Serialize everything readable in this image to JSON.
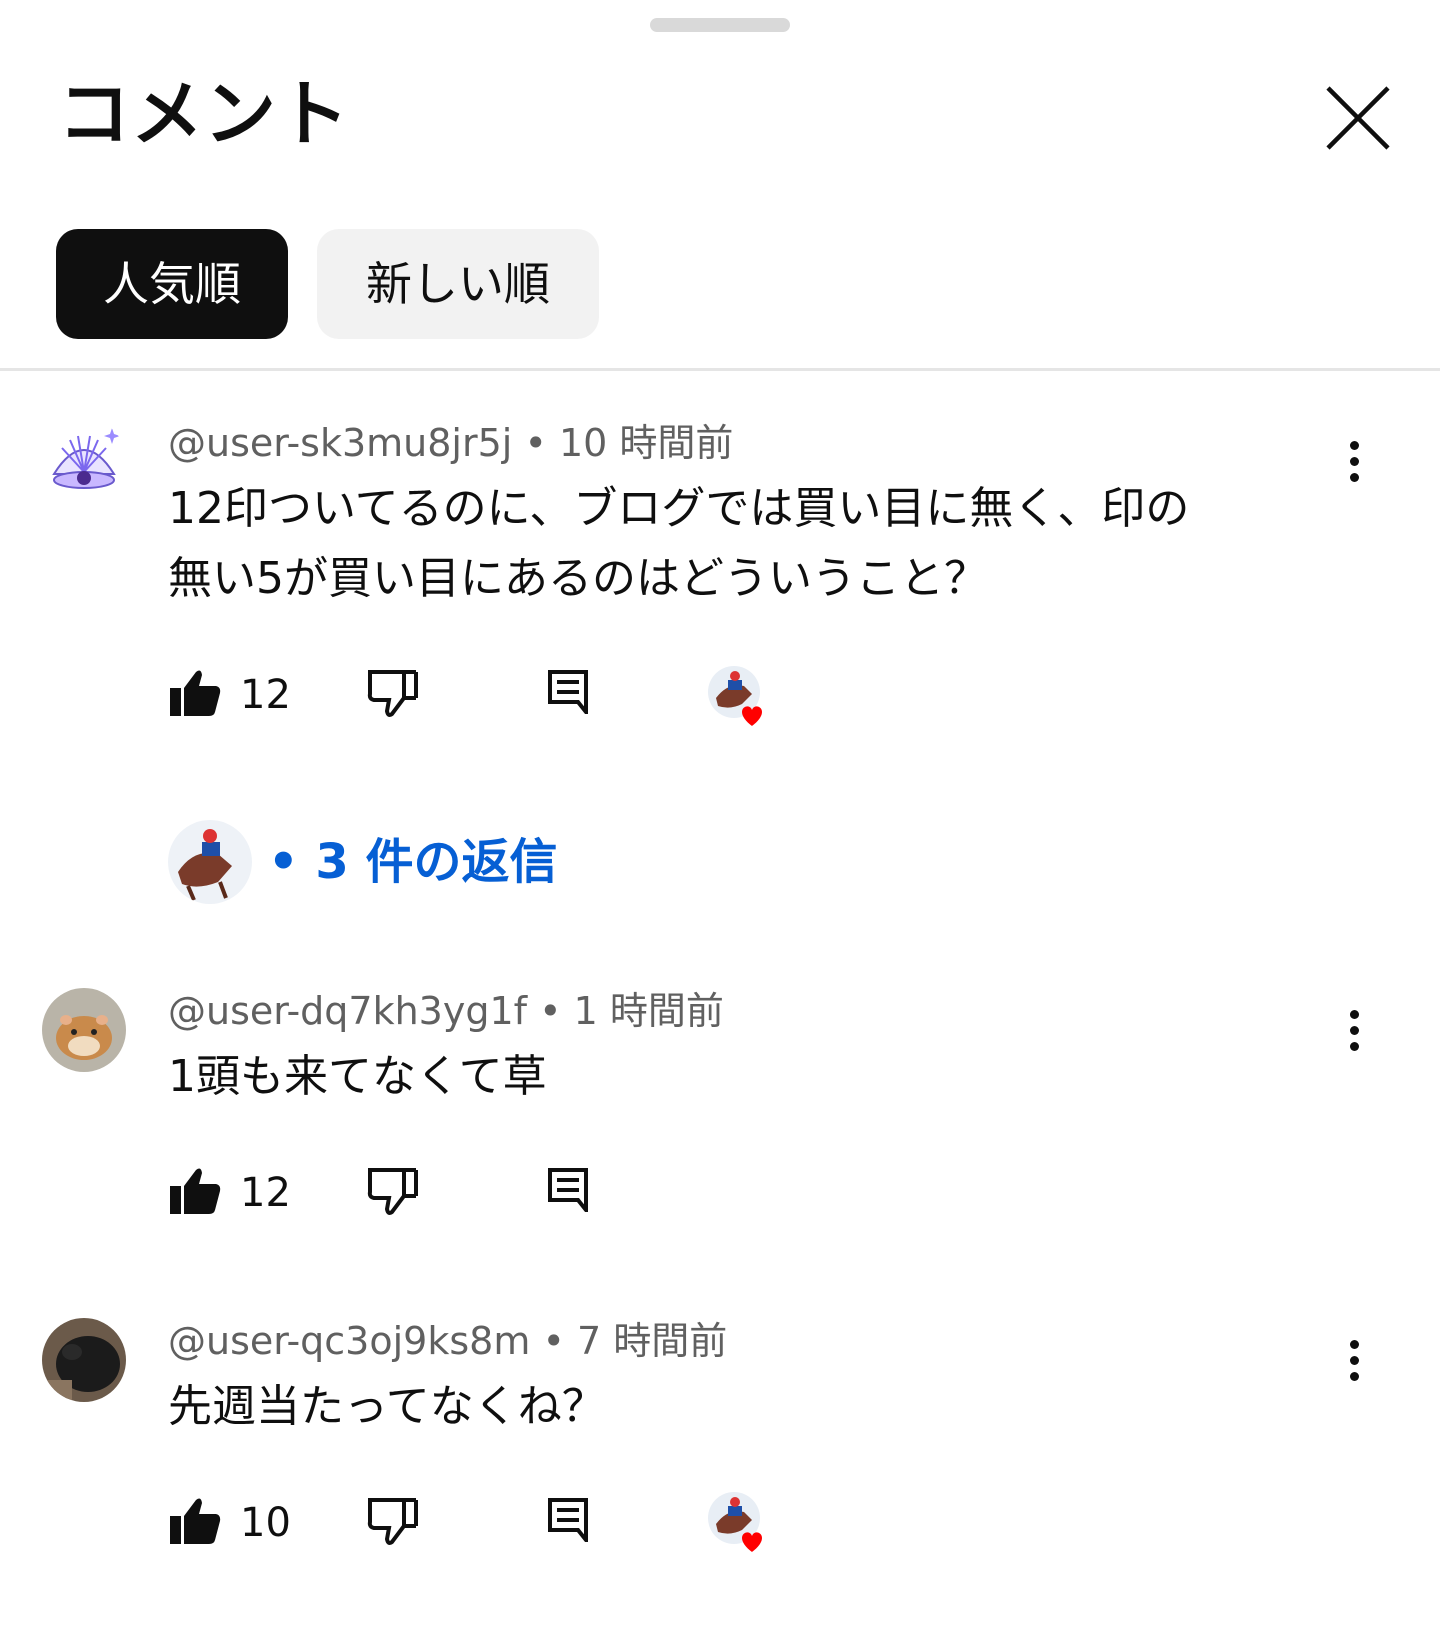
{
  "header": {
    "title": "コメント"
  },
  "sort_tabs": [
    {
      "label": "人気順",
      "active": true
    },
    {
      "label": "新しい順",
      "active": false
    }
  ],
  "comments": [
    {
      "author": "@user-sk3mu8jr5j",
      "time": "10 時間前",
      "text_lines": [
        "12印ついてるのに、ブログでは買い目に無く、印の",
        "無い5が買い目にあるのはどういうこと？"
      ],
      "likes": "12",
      "hearted": true,
      "replies": {
        "label": "• 3 件の返信"
      }
    },
    {
      "author": "@user-dq7kh3yg1f",
      "time": "1 時間前",
      "text_lines": [
        "1頭も来てなくて草"
      ],
      "likes": "12",
      "hearted": false
    },
    {
      "author": "@user-qc3oj9ks8m",
      "time": "7 時間前",
      "text_lines": [
        "先週当たってなくね？"
      ],
      "likes": "10",
      "hearted": true
    }
  ],
  "colors": {
    "accent_link": "#065fd4",
    "heart": "#ff0000",
    "meta_gray": "#606060"
  },
  "icons": [
    "close-icon",
    "like-icon",
    "dislike-icon",
    "reply-icon",
    "more-vert-icon",
    "heart-icon"
  ]
}
